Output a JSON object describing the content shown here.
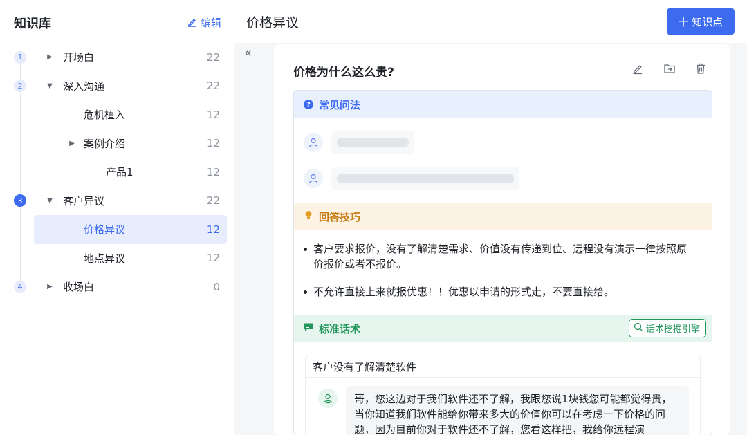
{
  "sidebar": {
    "title": "知识库",
    "edit_label": "编辑",
    "items": [
      {
        "num": "1",
        "label": "开场白",
        "count": "22"
      },
      {
        "num": "2",
        "label": "深入沟通",
        "count": "22"
      },
      {
        "label": "危机植入",
        "count": "12"
      },
      {
        "label": "案例介绍",
        "count": "12"
      },
      {
        "label": "产品1",
        "count": "12"
      },
      {
        "num": "3",
        "label": "客户异议",
        "count": "22"
      },
      {
        "label": "价格异议",
        "count": "12"
      },
      {
        "label": "地点异议",
        "count": "12"
      },
      {
        "num": "4",
        "label": "收场白",
        "count": "0"
      }
    ]
  },
  "header": {
    "title": "价格异议",
    "add_button": "十 知识点",
    "collapse_glyph": "«"
  },
  "card": {
    "question": "价格为什么这么贵?",
    "sections": {
      "faq": {
        "title": "常见问法",
        "icon": "?"
      },
      "tips": {
        "title": "回答技巧",
        "items": [
          "客户要求报价，没有了解清楚需求、价值没有传递到位、远程没有演示一律按照原价报价或者不报价。",
          "不允许直接上来就报优惠！！优惠以申请的形式走，不要直接给。"
        ]
      },
      "script": {
        "title": "标准话术",
        "mine_button": "话术挖掘引擎",
        "case_title": "客户没有了解清楚软件",
        "answer": "哥，您这边对于我们软件还不了解，我跟您说1块钱您可能都觉得贵，当你知道我们软件能给你带来多大的价值你可以在考虑一下价格的问题，因为目前你对于软件还不了解，您看这样把，我给你远程演"
      }
    }
  },
  "colors": {
    "accent": "#3d6bf0",
    "orange": "#c77a0f",
    "green": "#23965c"
  }
}
